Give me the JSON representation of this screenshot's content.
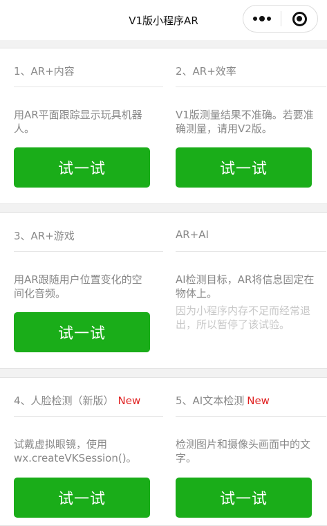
{
  "navbar": {
    "title": "V1版小程序AR",
    "more_icon": "more-dots-icon",
    "close_icon": "target-circle-icon"
  },
  "sections": [
    {
      "left": {
        "title": "1、AR+内容",
        "desc": "用AR平面跟踪显示玩具机器人。",
        "button": "试一试"
      },
      "right": {
        "title": "2、AR+效率",
        "desc": "V1版测量结果不准确。若要准确测量，请用V2版。",
        "button": "试一试"
      }
    },
    {
      "left": {
        "title": "3、AR+游戏",
        "desc": "用AR跟随用户位置变化的空间化音频。",
        "button": "试一试"
      },
      "right": {
        "title": "AR+AI",
        "desc": "AI检测目标，AR将信息固定在物体上。",
        "note": "因为小程序内存不足而经常退出，所以暂停了该试验。"
      }
    },
    {
      "left": {
        "title": "4、人脸检测（新版）",
        "badge": "New",
        "desc": "试戴虚拟眼镜，使用wx.createVKSession()。",
        "button": "试一试"
      },
      "right": {
        "title": "5、AI文本检测",
        "badge": "New",
        "desc": "检测图片和摄像头画面中的文字。",
        "button": "试一试"
      }
    }
  ],
  "colors": {
    "accent": "#1aad19",
    "badge": "#e02020",
    "text_muted": "#888888",
    "note": "#c8c8c8"
  }
}
